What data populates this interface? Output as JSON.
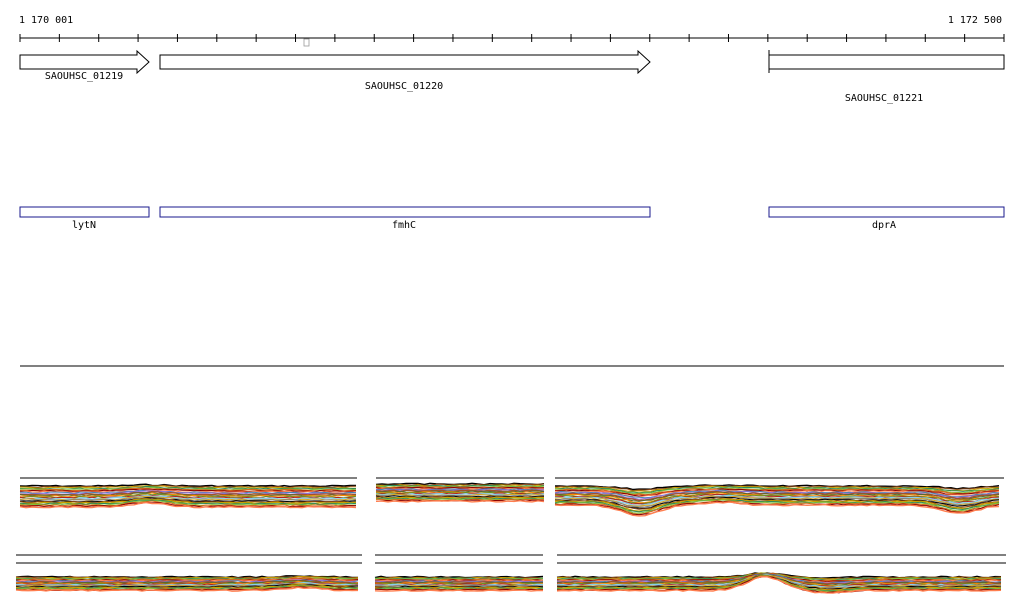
{
  "ruler": {
    "start_label": "1 170 001",
    "end_label": "1 172 500"
  },
  "loci": [
    {
      "label": "SAOUHSC_01219",
      "strand": "+",
      "complete_end": true
    },
    {
      "label": "SAOUHSC_01220",
      "strand": "+",
      "complete_end": true
    },
    {
      "label": "SAOUHSC_01221",
      "strand": "+",
      "complete_end": false
    }
  ],
  "genes": [
    {
      "label": "lytN"
    },
    {
      "label": "fmhC"
    },
    {
      "label": "dprA"
    }
  ],
  "colors": {
    "locus_outline": "#000000",
    "gene_outline": "#1a1a8c",
    "track_palette": [
      "#000000",
      "#8b4513",
      "#c8a000",
      "#2e8b57",
      "#7fbf3f",
      "#d2691e",
      "#8b0000",
      "#ff7f50",
      "#4682b4",
      "#9370db",
      "#a0522d",
      "#556b2f",
      "#ff8c00",
      "#6b8e23",
      "#b22222",
      "#87ceeb",
      "#daa520",
      "#808080"
    ]
  }
}
